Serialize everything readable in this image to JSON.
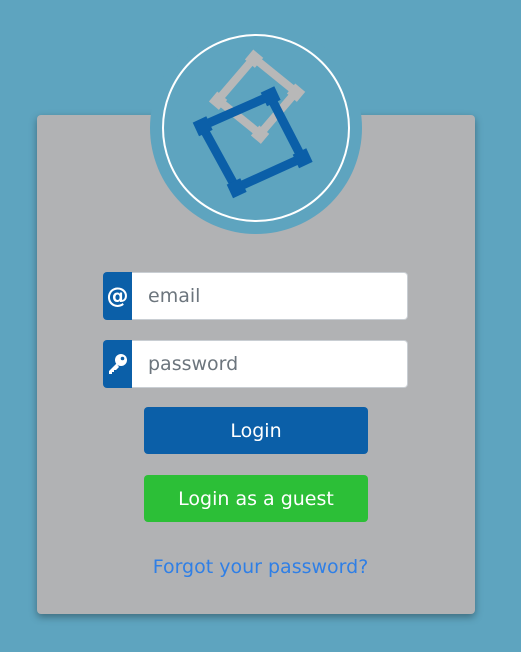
{
  "form": {
    "email_placeholder": "email",
    "password_placeholder": "password",
    "email_addon": "@"
  },
  "buttons": {
    "login_label": "Login",
    "guest_label": "Login as a guest"
  },
  "links": {
    "forgot_password": "Forgot your password?"
  },
  "icons": {
    "logo": "app-logo-icon",
    "email": "at-sign-icon",
    "password": "key-icon"
  },
  "colors": {
    "background": "#5ea4bf",
    "card": "#b1b2b4",
    "primary": "#0b5fa8",
    "success": "#2cbf37",
    "link": "#2f7fe6"
  }
}
